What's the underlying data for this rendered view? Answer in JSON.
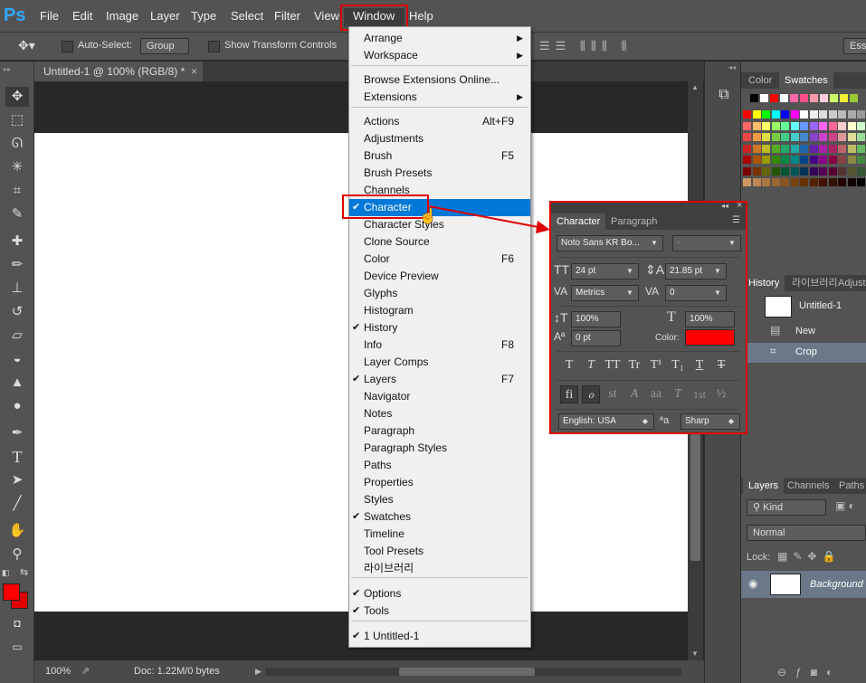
{
  "app": {
    "logo": "Ps"
  },
  "menubar": {
    "items": [
      "File",
      "Edit",
      "Image",
      "Layer",
      "Type",
      "Select",
      "Filter",
      "View",
      "Window",
      "Help"
    ]
  },
  "options": {
    "auto_select": "Auto-Select:",
    "group": "Group",
    "show_transform": "Show Transform Controls",
    "workspace": "Ess"
  },
  "document": {
    "tab_title": "Untitled-1 @ 100% (RGB/8) *",
    "close": "×"
  },
  "status": {
    "zoom": "100%",
    "doc": "Doc: 1.22M/0 bytes"
  },
  "window_menu": {
    "items": [
      {
        "label": "Arrange",
        "arrow": true
      },
      {
        "label": "Workspace",
        "arrow": true
      },
      {
        "label": "Browse Extensions Online..."
      },
      {
        "label": "Extensions",
        "arrow": true
      },
      {
        "label": "Actions",
        "shortcut": "Alt+F9"
      },
      {
        "label": "Adjustments"
      },
      {
        "label": "Brush",
        "shortcut": "F5"
      },
      {
        "label": "Brush Presets"
      },
      {
        "label": "Channels"
      },
      {
        "label": "Character",
        "checked": true,
        "selected": true
      },
      {
        "label": "Character Styles"
      },
      {
        "label": "Clone Source"
      },
      {
        "label": "Color",
        "shortcut": "F6"
      },
      {
        "label": "Device Preview"
      },
      {
        "label": "Glyphs"
      },
      {
        "label": "Histogram"
      },
      {
        "label": "History",
        "checked": true
      },
      {
        "label": "Info",
        "shortcut": "F8"
      },
      {
        "label": "Layer Comps"
      },
      {
        "label": "Layers",
        "shortcut": "F7",
        "checked": true
      },
      {
        "label": "Navigator"
      },
      {
        "label": "Notes"
      },
      {
        "label": "Paragraph"
      },
      {
        "label": "Paragraph Styles"
      },
      {
        "label": "Paths"
      },
      {
        "label": "Properties"
      },
      {
        "label": "Styles"
      },
      {
        "label": "Swatches",
        "checked": true
      },
      {
        "label": "Timeline"
      },
      {
        "label": "Tool Presets"
      },
      {
        "label": "라이브러리"
      },
      {
        "label": "Options",
        "checked": true
      },
      {
        "label": "Tools",
        "checked": true
      },
      {
        "label": "1 Untitled-1",
        "checked": true
      }
    ],
    "check_glyph": "✔",
    "arrow_glyph": "▶"
  },
  "character_panel": {
    "tabs": [
      "Character",
      "Paragraph"
    ],
    "font_family": "Noto Sans KR Bo...",
    "font_style": "-",
    "font_size": "24 pt",
    "leading": "21.85 pt",
    "kerning": "Metrics",
    "tracking": "0",
    "vscale": "100%",
    "hscale": "100%",
    "baseline": "0 pt",
    "color_label": "Color:",
    "color": "#ff0000",
    "style_glyphs": [
      "T",
      "T",
      "TT",
      "Tr",
      "T¹",
      "T₁",
      "T",
      "T"
    ],
    "ot_glyphs": [
      "fi",
      "ℴ",
      "st",
      "A",
      "aa",
      "T",
      "1st",
      "½"
    ],
    "language": "English: USA",
    "aa_icon": "ªa",
    "antialias": "Sharp"
  },
  "swatches_panel": {
    "tabs": [
      "Color",
      "Swatches"
    ]
  },
  "history_panel": {
    "tabs": [
      "History",
      "라이브러리",
      "Adjust"
    ],
    "snapshot": "Untitled-1",
    "steps": [
      "New",
      "Crop"
    ]
  },
  "layers_panel": {
    "tabs": [
      "Layers",
      "Channels",
      "Paths"
    ],
    "filter": "Kind",
    "blend": "Normal",
    "lock_label": "Lock:",
    "layer": "Background"
  },
  "colors": {
    "foreground": "#ff0000",
    "background": "#e00000",
    "accent": "#0078d7",
    "highlight_box": "#e00000"
  }
}
